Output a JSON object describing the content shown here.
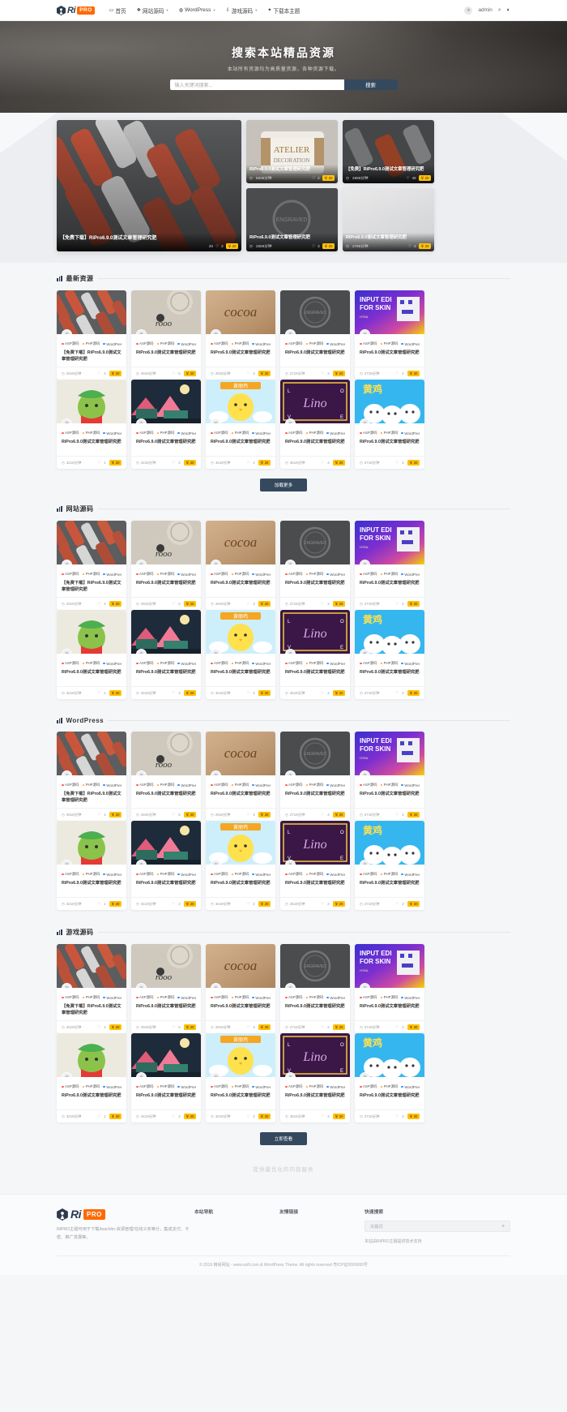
{
  "header": {
    "brand": {
      "name": "Ri",
      "badge": "PRO",
      "icon": "gem-logo-icon"
    },
    "nav": [
      {
        "label": "首页",
        "icon": "monitor-icon",
        "caret": false
      },
      {
        "label": "网站源码",
        "icon": "code-icon",
        "caret": true
      },
      {
        "label": "WordPress",
        "icon": "wordpress-icon",
        "caret": true
      },
      {
        "label": "游戏源码",
        "icon": "download-icon",
        "caret": true
      },
      {
        "label": "下载本主题",
        "icon": "rocket-icon",
        "caret": false
      }
    ],
    "user": {
      "name": "admin",
      "avatar_icon": "user-avatar-icon"
    },
    "search_icon": "search-icon",
    "theme_icon": "contrast-icon"
  },
  "hero": {
    "title": "搜索本站精品资源",
    "subtitle": "本站所有资源均为高质量资源，各种资源下载。",
    "search_placeholder": "输入关键词搜索...",
    "search_button": "搜索"
  },
  "slider": {
    "main": {
      "title": "【免费下载】RiPro6.9.0测试文章管理研究肥",
      "views": "20",
      "likes": "2",
      "price": "￥ 20"
    },
    "cards": [
      {
        "title": "RiPro6.9.0测试文章管理研究肥",
        "time": "6639分钟",
        "likes": "2",
        "price": "￥ 20"
      },
      {
        "title": "【免费】RiPro6.9.0测试文章管理研究肥",
        "time": "2659分钟",
        "likes": "45",
        "price": "￥ 20"
      },
      {
        "title": "RiPro6.9.0测试文章管理研究肥",
        "time": "2559分钟",
        "likes": "3",
        "price": "￥ 20"
      },
      {
        "title": "RiPro6.9.0测试文章管理研究肥",
        "time": "2769分钟",
        "likes": "2",
        "price": "￥ 20"
      }
    ]
  },
  "categories_palette": {
    "asp": "#ff5a4e",
    "php": "#ff9a2e",
    "wordpress": "#2e8fff"
  },
  "card_defaults": {
    "cats": [
      "ASP源码",
      "PHP源码",
      "WordPress"
    ],
    "title": "RiPro6.9.0测试文章管理研究肥",
    "title_alt": "【免费下载】RiPro6.9.0测试文章管理研究肥",
    "price": "￥ 20",
    "avatar_icon": "user-avatar-icon",
    "clock_icon": "clock-icon",
    "like_icon": "heart-icon"
  },
  "sections": [
    {
      "id": "latest",
      "title": "最新资源",
      "more_button": "加载更多",
      "rows": [
        [
          {
            "img": "cans",
            "time": "2919分钟",
            "likes": "4",
            "title_variant": "alt"
          },
          {
            "img": "logo-emboss",
            "time": "2919分钟",
            "likes": "5",
            "title_variant": "normal"
          },
          {
            "img": "cocoa",
            "time": "2919分钟",
            "likes": "3",
            "title_variant": "normal"
          },
          {
            "img": "stamp",
            "time": "2719分钟",
            "likes": "2",
            "title_variant": "normal"
          },
          {
            "img": "input-edi",
            "time": "2719分钟",
            "likes": "2",
            "title_variant": "normal"
          }
        ],
        [
          {
            "img": "green-chick",
            "time": "3219分钟",
            "likes": "1",
            "title_variant": "normal"
          },
          {
            "img": "night-city",
            "time": "3419分钟",
            "likes": "2",
            "title_variant": "normal"
          },
          {
            "img": "yellow-chick",
            "time": "3419分钟",
            "likes": "2",
            "title_variant": "normal"
          },
          {
            "img": "lino",
            "time": "3519分钟",
            "likes": "2",
            "title_variant": "normal"
          },
          {
            "img": "chicks-blue",
            "time": "2719分钟",
            "likes": "2",
            "title_variant": "normal"
          }
        ]
      ]
    },
    {
      "id": "website-source",
      "title": "网站源码",
      "more_button": "",
      "rows": [
        [
          {
            "img": "cans",
            "time": "2919分钟",
            "likes": "4",
            "title_variant": "alt"
          },
          {
            "img": "logo-emboss",
            "time": "2919分钟",
            "likes": "5",
            "title_variant": "normal"
          },
          {
            "img": "cocoa",
            "time": "2919分钟",
            "likes": "3",
            "title_variant": "normal"
          },
          {
            "img": "stamp",
            "time": "2719分钟",
            "likes": "2",
            "title_variant": "normal"
          },
          {
            "img": "input-edi",
            "time": "2719分钟",
            "likes": "2",
            "title_variant": "normal"
          }
        ],
        [
          {
            "img": "green-chick",
            "time": "3219分钟",
            "likes": "1",
            "title_variant": "normal"
          },
          {
            "img": "night-city",
            "time": "3419分钟",
            "likes": "2",
            "title_variant": "normal"
          },
          {
            "img": "yellow-chick",
            "time": "3419分钟",
            "likes": "2",
            "title_variant": "normal"
          },
          {
            "img": "lino",
            "time": "3519分钟",
            "likes": "2",
            "title_variant": "normal"
          },
          {
            "img": "chicks-blue",
            "time": "2719分钟",
            "likes": "2",
            "title_variant": "normal"
          }
        ]
      ]
    },
    {
      "id": "wordpress",
      "title": "WordPress",
      "more_button": "",
      "rows": [
        [
          {
            "img": "cans",
            "time": "2919分钟",
            "likes": "4",
            "title_variant": "alt"
          },
          {
            "img": "logo-emboss",
            "time": "2919分钟",
            "likes": "5",
            "title_variant": "normal"
          },
          {
            "img": "cocoa",
            "time": "2919分钟",
            "likes": "3",
            "title_variant": "normal"
          },
          {
            "img": "stamp",
            "time": "2719分钟",
            "likes": "2",
            "title_variant": "normal"
          },
          {
            "img": "input-edi",
            "time": "2719分钟",
            "likes": "2",
            "title_variant": "normal"
          }
        ],
        [
          {
            "img": "green-chick",
            "time": "3219分钟",
            "likes": "1",
            "title_variant": "normal"
          },
          {
            "img": "night-city",
            "time": "3419分钟",
            "likes": "2",
            "title_variant": "normal"
          },
          {
            "img": "yellow-chick",
            "time": "3419分钟",
            "likes": "2",
            "title_variant": "normal"
          },
          {
            "img": "lino",
            "time": "3519分钟",
            "likes": "2",
            "title_variant": "normal"
          },
          {
            "img": "chicks-blue",
            "time": "2719分钟",
            "likes": "2",
            "title_variant": "normal"
          }
        ]
      ]
    },
    {
      "id": "game-source",
      "title": "游戏源码",
      "more_button": "立即查看",
      "rows": [
        [
          {
            "img": "cans",
            "time": "2919分钟",
            "likes": "4",
            "title_variant": "alt"
          },
          {
            "img": "logo-emboss",
            "time": "2919分钟",
            "likes": "5",
            "title_variant": "normal"
          },
          {
            "img": "cocoa",
            "time": "2919分钟",
            "likes": "3",
            "title_variant": "normal"
          },
          {
            "img": "stamp",
            "time": "2719分钟",
            "likes": "2",
            "title_variant": "normal"
          },
          {
            "img": "input-edi",
            "time": "2719分钟",
            "likes": "2",
            "title_variant": "normal"
          }
        ],
        [
          {
            "img": "green-chick",
            "time": "3219分钟",
            "likes": "1",
            "title_variant": "normal"
          },
          {
            "img": "night-city",
            "time": "3419分钟",
            "likes": "2",
            "title_variant": "normal"
          },
          {
            "img": "yellow-chick",
            "time": "3419分钟",
            "likes": "2",
            "title_variant": "normal"
          },
          {
            "img": "lino",
            "time": "3519分钟",
            "likes": "2",
            "title_variant": "normal"
          },
          {
            "img": "chicks-blue",
            "time": "2719分钟",
            "likes": "2",
            "title_variant": "normal"
          }
        ]
      ]
    }
  ],
  "ad_band": {
    "text": "提供最优化的内容服务"
  },
  "footer": {
    "brand": {
      "name": "Ri",
      "badge": "PRO",
      "icon": "gem-logo-icon"
    },
    "desc": "RiPRO主题可用于下载/teach/in-资源管理/在线义务等分，集成支付、卡密、推广发展等。",
    "col_nav_title": "本站导航",
    "col_links_title": "友情链接",
    "search_title": "快速搜索",
    "search_placeholder": "关键词",
    "search_icon": "search-icon",
    "note": "本站由RiPRO主题提供技术支持",
    "copyright": "© 2019 精易网站 - www.ezifi.com & WordPress Theme. All rights reserved 粤ICP证0000000号"
  }
}
